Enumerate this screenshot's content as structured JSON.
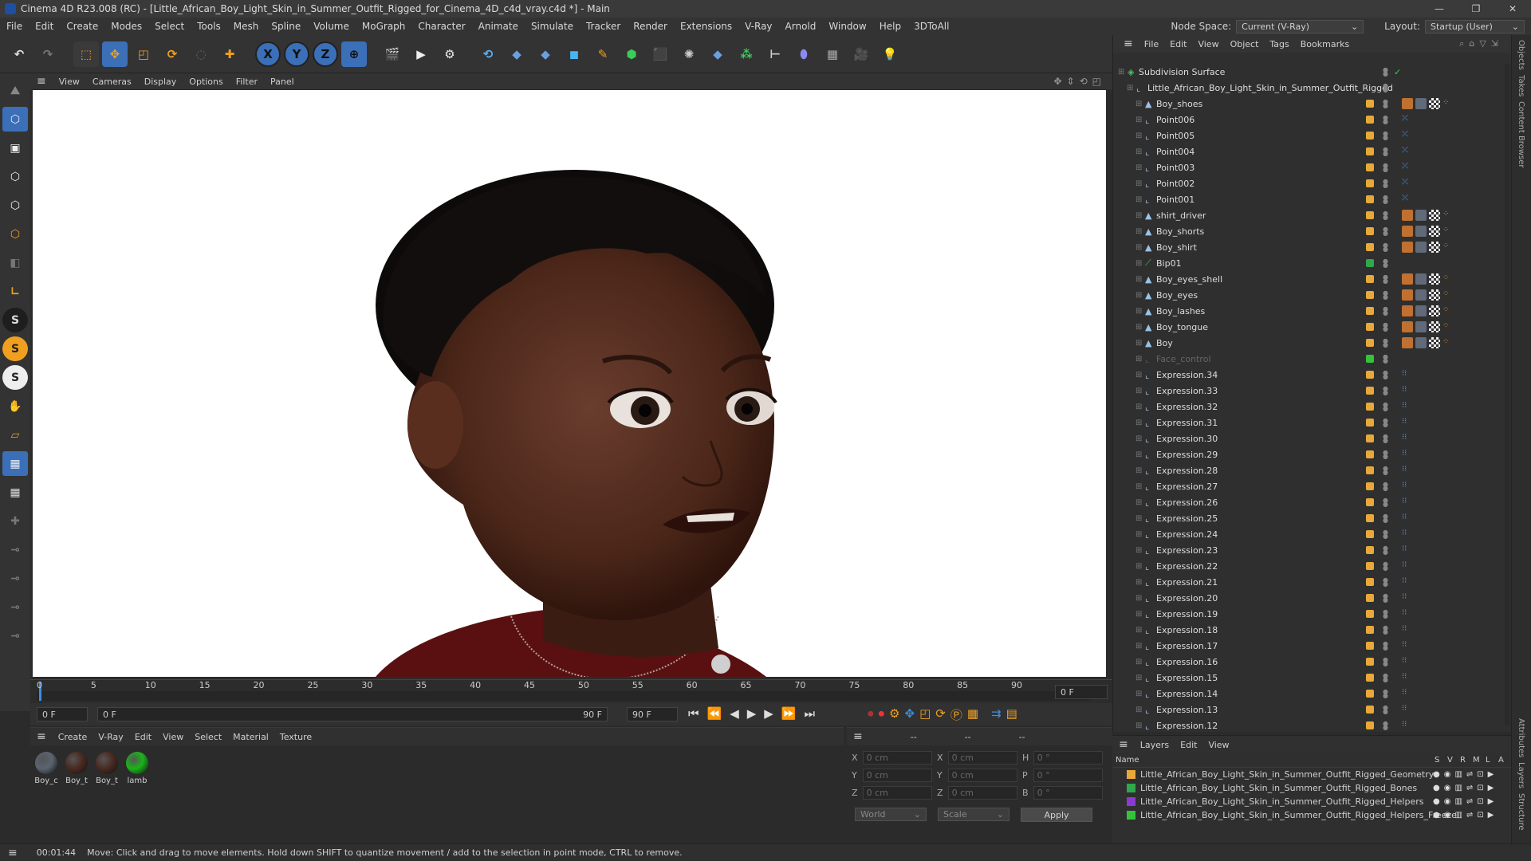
{
  "window": {
    "title": "Cinema 4D R23.008 (RC) - [Little_African_Boy_Light_Skin_in_Summer_Outfit_Rigged_for_Cinema_4D_c4d_vray.c4d *] - Main",
    "controls": [
      "—",
      "❐",
      "✕"
    ]
  },
  "menubar": {
    "items": [
      "File",
      "Edit",
      "Create",
      "Modes",
      "Select",
      "Tools",
      "Mesh",
      "Spline",
      "Volume",
      "MoGraph",
      "Character",
      "Animate",
      "Simulate",
      "Tracker",
      "Render",
      "Extensions",
      "V-Ray",
      "Arnold",
      "Window",
      "Help",
      "3DToAll"
    ],
    "node_space_label": "Node Space:",
    "node_space_value": "Current (V-Ray)",
    "layout_label": "Layout:",
    "layout_value": "Startup (User)"
  },
  "toolbar": {
    "axis_labels": [
      "X",
      "Y",
      "Z"
    ]
  },
  "viewport": {
    "menu": [
      "View",
      "Cameras",
      "Display",
      "Options",
      "Filter",
      "Panel"
    ]
  },
  "timeline": {
    "ticks": [
      "0",
      "5",
      "10",
      "15",
      "20",
      "25",
      "30",
      "35",
      "40",
      "45",
      "50",
      "55",
      "60",
      "65",
      "70",
      "75",
      "80",
      "85",
      "90"
    ],
    "current_frame": "0 F",
    "start_field": "0 F",
    "range_start": "0 F",
    "range_end": "90 F",
    "end_field": "90 F"
  },
  "material_manager": {
    "menu": [
      "Create",
      "V-Ray",
      "Edit",
      "View",
      "Select",
      "Material",
      "Texture"
    ],
    "materials": [
      {
        "label": "Boy_c",
        "color": "#5a6470"
      },
      {
        "label": "Boy_t",
        "color": "#4a2a22"
      },
      {
        "label": "Boy_t",
        "color": "#4a2a22"
      },
      {
        "label": "lamb",
        "color": "#19b519"
      }
    ]
  },
  "coordinates": {
    "header": [
      "--",
      "--",
      "--"
    ],
    "rows": [
      {
        "a": "X",
        "av": "0 cm",
        "b": "X",
        "bv": "0 cm",
        "c": "H",
        "cv": "0 °"
      },
      {
        "a": "Y",
        "av": "0 cm",
        "b": "Y",
        "bv": "0 cm",
        "c": "P",
        "cv": "0 °"
      },
      {
        "a": "Z",
        "av": "0 cm",
        "b": "Z",
        "bv": "0 cm",
        "c": "B",
        "cv": "0 °"
      }
    ],
    "space": "World",
    "mode": "Scale",
    "apply_label": "Apply"
  },
  "object_manager": {
    "menu": [
      "File",
      "Edit",
      "View",
      "Object",
      "Tags",
      "Bookmarks"
    ],
    "objects": [
      {
        "name": "Subdivision Surface",
        "indent": 0,
        "tag_color": "",
        "kind": "subd"
      },
      {
        "name": "Little_African_Boy_Light_Skin_in_Summer_Outfit_Rigged",
        "indent": 1,
        "tag_color": "",
        "kind": "null"
      },
      {
        "name": "Boy_shoes",
        "indent": 2,
        "tag_color": "#e8a93a",
        "kind": "mesh"
      },
      {
        "name": "Point006",
        "indent": 2,
        "tag_color": "#e8a93a",
        "kind": "null"
      },
      {
        "name": "Point005",
        "indent": 2,
        "tag_color": "#e8a93a",
        "kind": "null"
      },
      {
        "name": "Point004",
        "indent": 2,
        "tag_color": "#e8a93a",
        "kind": "null"
      },
      {
        "name": "Point003",
        "indent": 2,
        "tag_color": "#e8a93a",
        "kind": "null"
      },
      {
        "name": "Point002",
        "indent": 2,
        "tag_color": "#e8a93a",
        "kind": "null"
      },
      {
        "name": "Point001",
        "indent": 2,
        "tag_color": "#e8a93a",
        "kind": "null"
      },
      {
        "name": "shirt_driver",
        "indent": 2,
        "tag_color": "#e8a93a",
        "kind": "mesh"
      },
      {
        "name": "Boy_shorts",
        "indent": 2,
        "tag_color": "#e8a93a",
        "kind": "mesh"
      },
      {
        "name": "Boy_shirt",
        "indent": 2,
        "tag_color": "#e8a93a",
        "kind": "mesh"
      },
      {
        "name": "Bip01",
        "indent": 2,
        "tag_color": "#2ea84a",
        "kind": "bone"
      },
      {
        "name": "Boy_eyes_shell",
        "indent": 2,
        "tag_color": "#e8a93a",
        "kind": "mesh"
      },
      {
        "name": "Boy_eyes",
        "indent": 2,
        "tag_color": "#e8a93a",
        "kind": "mesh"
      },
      {
        "name": "Boy_lashes",
        "indent": 2,
        "tag_color": "#e8a93a",
        "kind": "mesh"
      },
      {
        "name": "Boy_tongue",
        "indent": 2,
        "tag_color": "#e8a93a",
        "kind": "mesh"
      },
      {
        "name": "Boy",
        "indent": 2,
        "tag_color": "#e8a93a",
        "kind": "mesh"
      },
      {
        "name": "Face_control",
        "indent": 2,
        "tag_color": "#34c43a",
        "kind": "dim"
      },
      {
        "name": "Expression.34",
        "indent": 2,
        "tag_color": "#e8a93a",
        "kind": "null"
      },
      {
        "name": "Expression.33",
        "indent": 2,
        "tag_color": "#e8a93a",
        "kind": "null"
      },
      {
        "name": "Expression.32",
        "indent": 2,
        "tag_color": "#e8a93a",
        "kind": "null"
      },
      {
        "name": "Expression.31",
        "indent": 2,
        "tag_color": "#e8a93a",
        "kind": "null"
      },
      {
        "name": "Expression.30",
        "indent": 2,
        "tag_color": "#e8a93a",
        "kind": "null"
      },
      {
        "name": "Expression.29",
        "indent": 2,
        "tag_color": "#e8a93a",
        "kind": "null"
      },
      {
        "name": "Expression.28",
        "indent": 2,
        "tag_color": "#e8a93a",
        "kind": "null"
      },
      {
        "name": "Expression.27",
        "indent": 2,
        "tag_color": "#e8a93a",
        "kind": "null"
      },
      {
        "name": "Expression.26",
        "indent": 2,
        "tag_color": "#e8a93a",
        "kind": "null"
      },
      {
        "name": "Expression.25",
        "indent": 2,
        "tag_color": "#e8a93a",
        "kind": "null"
      },
      {
        "name": "Expression.24",
        "indent": 2,
        "tag_color": "#e8a93a",
        "kind": "null"
      },
      {
        "name": "Expression.23",
        "indent": 2,
        "tag_color": "#e8a93a",
        "kind": "null"
      },
      {
        "name": "Expression.22",
        "indent": 2,
        "tag_color": "#e8a93a",
        "kind": "null"
      },
      {
        "name": "Expression.21",
        "indent": 2,
        "tag_color": "#e8a93a",
        "kind": "null"
      },
      {
        "name": "Expression.20",
        "indent": 2,
        "tag_color": "#e8a93a",
        "kind": "null"
      },
      {
        "name": "Expression.19",
        "indent": 2,
        "tag_color": "#e8a93a",
        "kind": "null"
      },
      {
        "name": "Expression.18",
        "indent": 2,
        "tag_color": "#e8a93a",
        "kind": "null"
      },
      {
        "name": "Expression.17",
        "indent": 2,
        "tag_color": "#e8a93a",
        "kind": "null"
      },
      {
        "name": "Expression.16",
        "indent": 2,
        "tag_color": "#e8a93a",
        "kind": "null"
      },
      {
        "name": "Expression.15",
        "indent": 2,
        "tag_color": "#e8a93a",
        "kind": "null"
      },
      {
        "name": "Expression.14",
        "indent": 2,
        "tag_color": "#e8a93a",
        "kind": "null"
      },
      {
        "name": "Expression.13",
        "indent": 2,
        "tag_color": "#e8a93a",
        "kind": "null"
      },
      {
        "name": "Expression.12",
        "indent": 2,
        "tag_color": "#e8a93a",
        "kind": "null"
      }
    ]
  },
  "layer_manager": {
    "menu": [
      "Layers",
      "Edit",
      "View"
    ],
    "columns": [
      "Name",
      "S",
      "V",
      "R",
      "M",
      "L",
      "A"
    ],
    "layers": [
      {
        "name": "Little_African_Boy_Light_Skin_in_Summer_Outfit_Rigged_Geometry",
        "color": "#e8a93a"
      },
      {
        "name": "Little_African_Boy_Light_Skin_in_Summer_Outfit_Rigged_Bones",
        "color": "#2ea84a"
      },
      {
        "name": "Little_African_Boy_Light_Skin_in_Summer_Outfit_Rigged_Helpers",
        "color": "#8a3ad0"
      },
      {
        "name": "Little_African_Boy_Light_Skin_in_Summer_Outfit_Rigged_Helpers_Freeze",
        "color": "#34c43a"
      }
    ]
  },
  "side_tabs": [
    "Objects",
    "Takes",
    "Content Browser",
    "Attributes",
    "Layers",
    "Structure"
  ],
  "status": {
    "time": "00:01:44",
    "message": "Move: Click and drag to move elements. Hold down SHIFT to quantize movement / add to the selection in point mode, CTRL to remove."
  },
  "colors": {
    "accent": "#3b8fe0",
    "bg": "#2b2b2b",
    "panel": "#333333"
  }
}
